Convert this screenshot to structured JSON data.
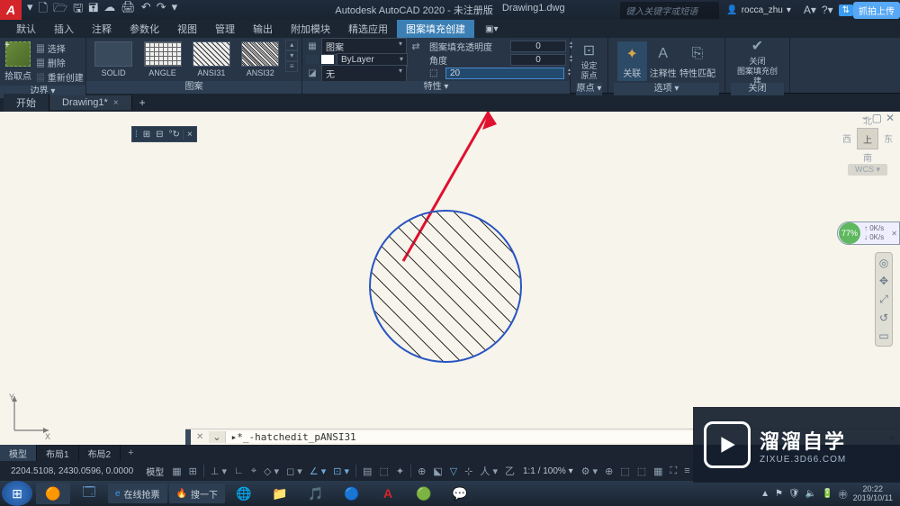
{
  "title": {
    "app": "Autodesk AutoCAD 2020 - 未注册版",
    "doc": "Drawing1.dwg"
  },
  "search_placeholder": "键入关键字或短语",
  "user": "rocca_zhu",
  "upload_label": "抓拍上传",
  "menus": [
    "默认",
    "插入",
    "注释",
    "参数化",
    "视图",
    "管理",
    "输出",
    "附加模块",
    "精选应用",
    "图案填充创建"
  ],
  "active_menu": 9,
  "ribbon": {
    "boundary": {
      "label": "边界",
      "pick": "拾取点",
      "opts": [
        "选择",
        "删除",
        "重新创建"
      ]
    },
    "patterns": {
      "label": "图案",
      "items": [
        "SOLID",
        "ANGLE",
        "ANSI31",
        "ANSI32"
      ]
    },
    "props": {
      "label": "特性",
      "pattern_dd": "图案",
      "layer_dd": "ByLayer",
      "bg_dd": "无",
      "transparency_lbl": "图案填充透明度",
      "transparency_val": "0",
      "angle_lbl": "角度",
      "angle_val": "0",
      "scale_icon_label": "缩放",
      "scale_val": "20"
    },
    "origin": {
      "label": "原点",
      "btn": "设定\n原点"
    },
    "options": {
      "label": "选项",
      "assoc": "关联",
      "annot": "注释性",
      "match": "特性匹配"
    },
    "close": {
      "label": "关闭",
      "btn": "关闭\n图案填充创建"
    }
  },
  "doc_tabs": {
    "start": "开始",
    "drawing": "Drawing1*"
  },
  "viewcube": {
    "top": "上",
    "n": "北",
    "s": "南",
    "e": "东",
    "w": "西",
    "wcs": "WCS"
  },
  "speed": {
    "pct": "77%",
    "up": "0K/s",
    "down": "0K/s"
  },
  "command": "▸*_-hatchedit_pANSI31",
  "layout_tabs": [
    "模型",
    "布局1",
    "布局2"
  ],
  "status": {
    "coords": "2204.5108, 2430.0596, 0.0000",
    "model": "模型",
    "scale": "1:1",
    "zoom": "100%"
  },
  "taskbar": {
    "task1": "在线抢票",
    "task2": "搜一下",
    "apps": [
      "🌐",
      "📁",
      "🎵",
      "🔵",
      "A",
      "🟢",
      "💬"
    ]
  },
  "clock": {
    "time": "20:22",
    "date": "2019/10/11"
  },
  "watermark": {
    "cn": "溜溜自学",
    "en": "ZIXUE.3D66.COM"
  }
}
